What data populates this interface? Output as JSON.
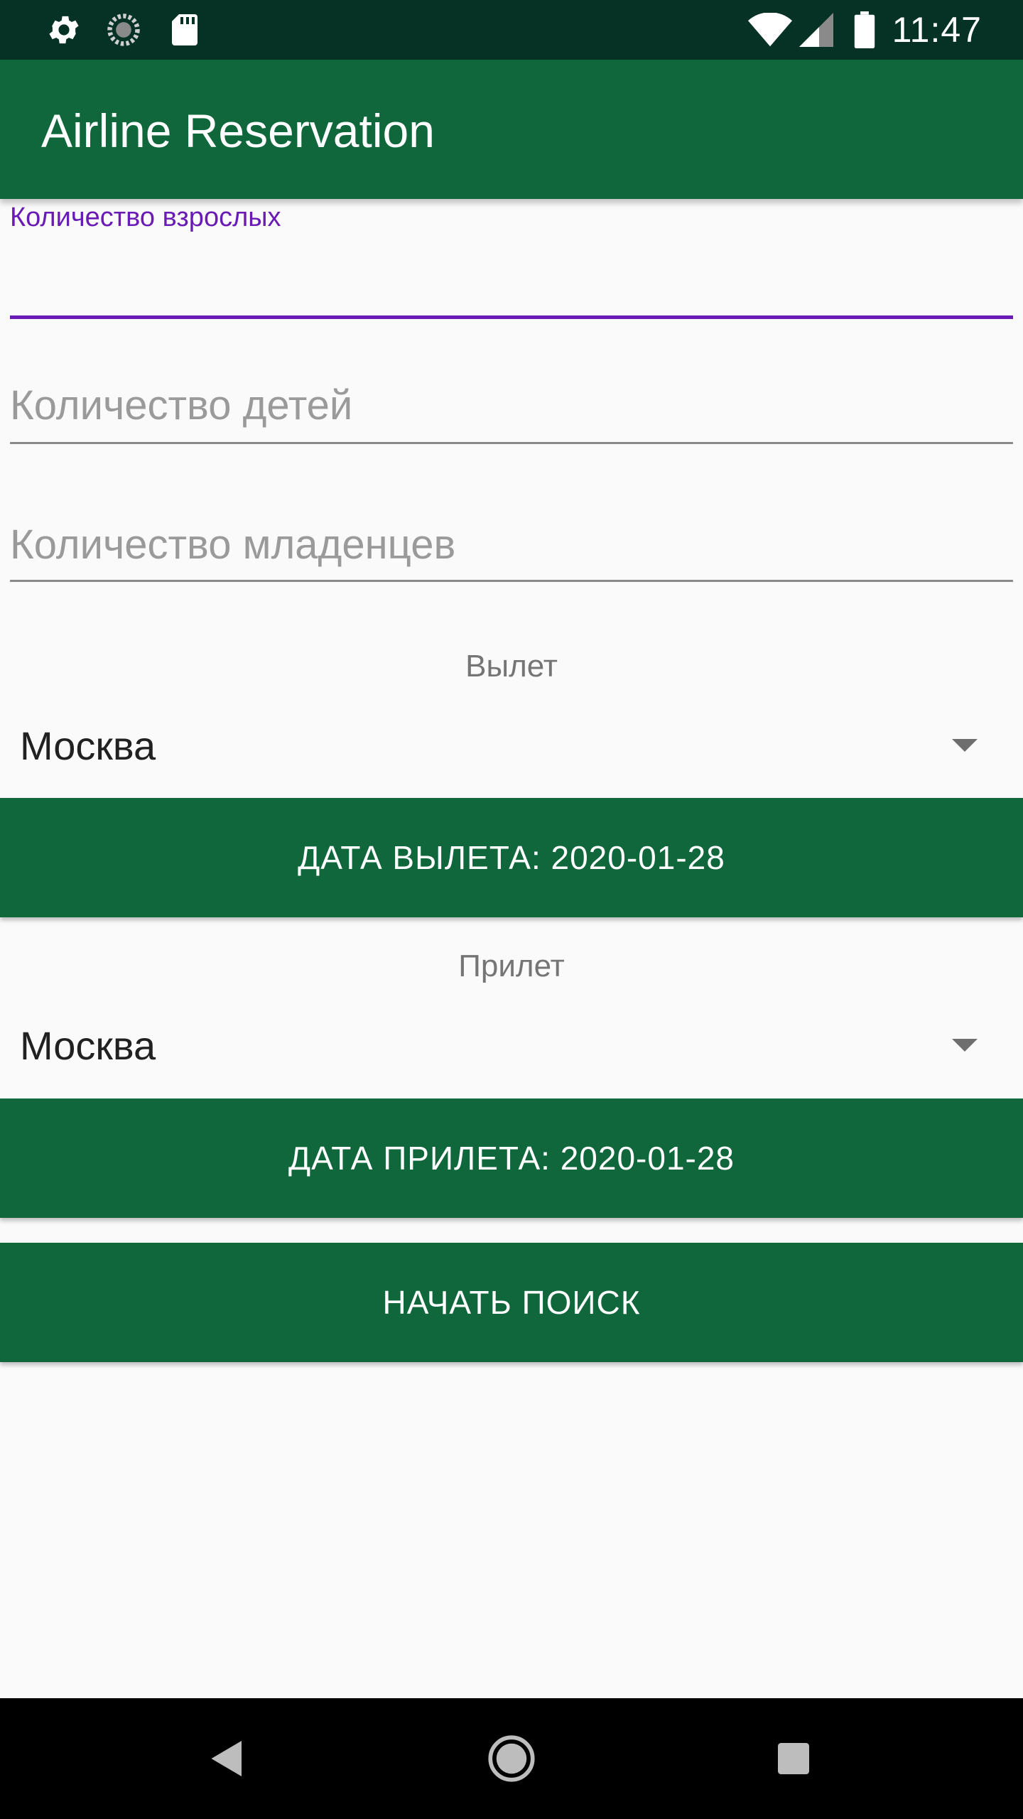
{
  "status_bar": {
    "time": "11:47",
    "icons": [
      "gear-icon",
      "sync-icon",
      "sd-card-icon",
      "wifi-icon",
      "cell-signal-icon",
      "battery-icon"
    ]
  },
  "app_bar": {
    "title": "Airline Reservation"
  },
  "form": {
    "adults": {
      "label": "Количество взрослых",
      "value": ""
    },
    "children": {
      "placeholder": "Количество детей",
      "value": ""
    },
    "infants": {
      "placeholder": "Количество младенцев",
      "value": ""
    },
    "departure": {
      "label": "Вылет",
      "selected": "Москва",
      "date_button": "ДАТА ВЫЛЕТА: 2020-01-28"
    },
    "arrival": {
      "label": "Прилет",
      "selected": "Москва",
      "date_button": "ДАТА ПРИЛЕТА: 2020-01-28"
    },
    "search_button": "НАЧАТЬ ПОИСК"
  },
  "nav_bar": {
    "icons": [
      "back-icon",
      "home-icon",
      "recents-icon"
    ]
  },
  "colors": {
    "status_bar": "#053225",
    "primary": "#10673b",
    "accent": "#6a1bb5",
    "background": "#fafafa"
  }
}
